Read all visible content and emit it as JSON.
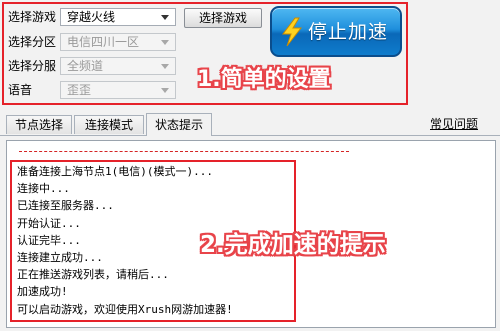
{
  "settings": {
    "game": {
      "label": "选择游戏",
      "value": "穿越火线"
    },
    "region": {
      "label": "选择分区",
      "value": "电信四川一区"
    },
    "server": {
      "label": "选择分服",
      "value": "全频道"
    },
    "voice": {
      "label": "语音",
      "value": "歪歪"
    },
    "select_game_button": "选择游戏",
    "stop_button": "停止加速"
  },
  "tabs": [
    {
      "label": "节点选择",
      "active": false
    },
    {
      "label": "连接模式",
      "active": false
    },
    {
      "label": "状态提示",
      "active": true
    }
  ],
  "help_link": "常见问题",
  "log": [
    "准备连接上海节点1(电信)(模式一)...",
    "连接中...",
    "已连接至服务器...",
    "开始认证...",
    "认证完毕...",
    "连接建立成功...",
    "正在推送游戏列表，请稍后...",
    "加速成功!",
    "可以启动游戏，欢迎使用Xrush网游加速器!"
  ],
  "annotations": {
    "settings_note": "1.简单的设置",
    "status_note": "2.完成加速的提示"
  },
  "colors": {
    "annotation_red": "#e5222a",
    "stop_button_blue": "#1f8fdc",
    "bolt_yellow": "#ffd21f"
  },
  "icons": {
    "stop_button_icon": "lightning-bolt-icon"
  }
}
